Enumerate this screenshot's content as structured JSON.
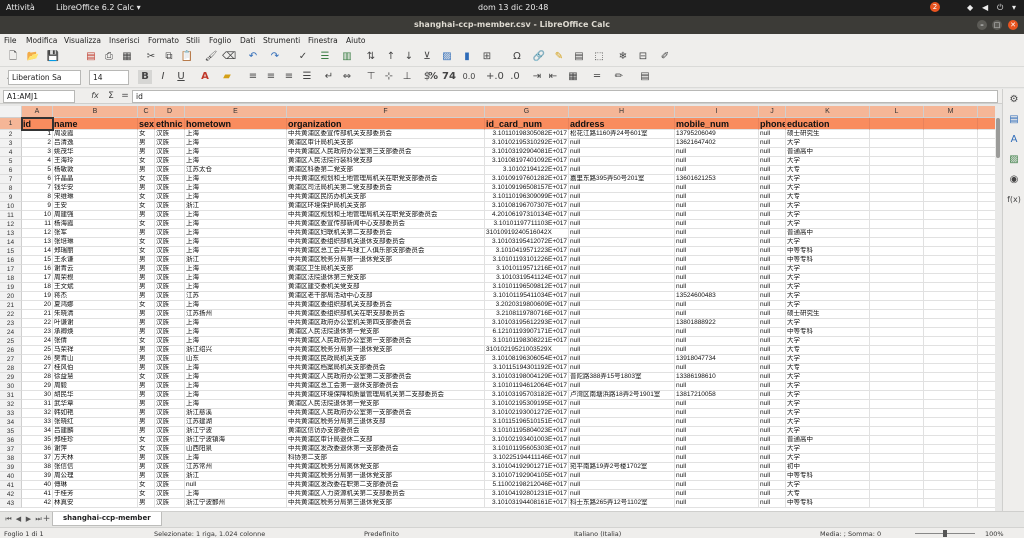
{
  "system_bar": {
    "activities": "Attività",
    "app_menu": "LibreOffice 6.2 Calc ▾",
    "clock": "dom 13 dic  20:48",
    "notification_count": "2"
  },
  "window": {
    "title": "shanghai-ccp-member.csv - LibreOffice Calc",
    "close_glyph": "✕",
    "maximize_glyph": "□",
    "minimize_glyph": "–"
  },
  "menubar": [
    "File",
    "Modifica",
    "Visualizza",
    "Inserisci",
    "Formato",
    "Stili",
    "Foglio",
    "Dati",
    "Strumenti",
    "Finestra",
    "Aiuto"
  ],
  "toolbar": {
    "font_name": "Liberation Sa",
    "font_size": "14",
    "bold": "B",
    "italic": "I",
    "underline": "U",
    "percent": "%",
    "number_format": "74",
    "decimal": "0.0",
    "icons": [
      "new-icon",
      "open-icon",
      "save-icon",
      "export-pdf-icon",
      "print-icon",
      "print-preview-icon",
      "cut-icon",
      "copy-icon",
      "paste-icon",
      "clone-icon",
      "clear-icon",
      "undo-icon",
      "redo-icon",
      "spellcheck-icon",
      "row-icon",
      "column-icon",
      "sort-icon",
      "sort-ascending-icon",
      "sort-descending-icon",
      "autofilter-icon",
      "image-icon",
      "chart-icon",
      "pivot-table-icon",
      "special-character-icon",
      "hyperlink-icon",
      "comment-icon",
      "header-footer-icon",
      "define-print-area-icon",
      "freeze-icon",
      "split-window-icon",
      "show-draw-icon"
    ]
  },
  "formula_bar": {
    "name_box": "A1:AMJ1",
    "fx": "fx",
    "sum": "Σ",
    "equals": "=",
    "content": "id"
  },
  "columns": [
    {
      "letter": "A",
      "header": "id"
    },
    {
      "letter": "B",
      "header": "name"
    },
    {
      "letter": "C",
      "header": "sex"
    },
    {
      "letter": "D",
      "header": "ethnic"
    },
    {
      "letter": "E",
      "header": "hometown"
    },
    {
      "letter": "F",
      "header": "organization"
    },
    {
      "letter": "G",
      "header": "id_card_num"
    },
    {
      "letter": "H",
      "header": "address"
    },
    {
      "letter": "I",
      "header": "mobile_num"
    },
    {
      "letter": "J",
      "header": "phone"
    },
    {
      "letter": "K",
      "header": "education"
    },
    {
      "letter": "L",
      "header": ""
    },
    {
      "letter": "M",
      "header": ""
    },
    {
      "letter": "N",
      "header": ""
    }
  ],
  "rows": [
    [
      "1",
      "周凌霞",
      "女",
      "汉族",
      "上海",
      "中共黄浦区委宣传部机关支部委员会",
      "3.10110198305082E+017",
      "松花江路1160弄24号601室",
      "13795206049",
      "null",
      "硕士研究生"
    ],
    [
      "2",
      "吕清逸",
      "男",
      "汉族",
      "上海",
      "黄浦区审计局机关支部",
      "3.10102195310292E+017",
      "null",
      "13621647402",
      "null",
      "大学"
    ],
    [
      "3",
      "姚茂华",
      "男",
      "汉族",
      "上海",
      "中共黄浦区人民政府办公室第三支部委员会",
      "3.10103192904081E+017",
      "null",
      "null",
      "null",
      "普通高中"
    ],
    [
      "4",
      "王海玲",
      "女",
      "汉族",
      "上海",
      "黄浦区人民法院行装科党支部",
      "3.10108197401092E+017",
      "null",
      "null",
      "null",
      "大学"
    ],
    [
      "5",
      "杨敏敦",
      "男",
      "汉族",
      "江苏太仓",
      "黄浦区科委第二党支部",
      "3.10102194122E+017",
      "null",
      "null",
      "null",
      "大专"
    ],
    [
      "6",
      "许晶晶",
      "女",
      "汉族",
      "上海",
      "中共黄浦区规划和土地管理局机关在职党支部委员会",
      "3.10109197601282E+017",
      "嘉里东路395弄50号201室",
      "13601621253",
      "null",
      "大学"
    ],
    [
      "7",
      "钱华安",
      "男",
      "汉族",
      "上海",
      "黄浦区司法局机关第二党支部委员会",
      "3.10109196508157E+017",
      "null",
      "null",
      "null",
      "大学"
    ],
    [
      "8",
      "宋维琳",
      "女",
      "汉族",
      "上海",
      "中共黄浦区民防办机关支部",
      "3.10110196309099E+017",
      "null",
      "null",
      "null",
      "大专"
    ],
    [
      "9",
      "王安",
      "女",
      "汉族",
      "浙江",
      "黄浦区环境保护局机关支部",
      "3.10108196707307E+017",
      "null",
      "null",
      "null",
      "大学"
    ],
    [
      "10",
      "周建强",
      "男",
      "汉族",
      "上海",
      "中共黄浦区规划和土地管理局机关在职党支部委员会",
      "4.20106197310134E+017",
      "null",
      "null",
      "null",
      "大学"
    ],
    [
      "11",
      "杨海霞",
      "女",
      "汉族",
      "上海",
      "中共黄浦区委宣传部新闻中心支部委员会",
      "3.10101197711103E+017",
      "null",
      "null",
      "null",
      "大学"
    ],
    [
      "12",
      "张军",
      "男",
      "汉族",
      "上海",
      "中共黄浦区妇联机关第二支部委员会",
      "31010919240516042X",
      "null",
      "null",
      "null",
      "普通高中"
    ],
    [
      "13",
      "张培琳",
      "女",
      "汉族",
      "上海",
      "中共黄浦区委组织部机关退休支部委员会",
      "3.10103195412072E+017",
      "null",
      "null",
      "null",
      "大学"
    ],
    [
      "14",
      "郑瑞丽",
      "女",
      "汉族",
      "上海",
      "中共黄浦区总工会乒乓球工人俱乐部支部委员会",
      "3.1010419571223E+017",
      "null",
      "null",
      "null",
      "中等专科"
    ],
    [
      "15",
      "王永谦",
      "男",
      "汉族",
      "浙江",
      "中共黄浦区税务分局第一退休党支部",
      "3.10101193101226E+017",
      "null",
      "null",
      "null",
      "中等专科"
    ],
    [
      "16",
      "谢青云",
      "男",
      "汉族",
      "上海",
      "黄浦区卫生局机关支部",
      "3.1010119571216E+017",
      "null",
      "null",
      "null",
      "大学"
    ],
    [
      "17",
      "周荣根",
      "男",
      "汉族",
      "上海",
      "黄浦区法院退休第三党支部",
      "3.1010319541124E+017",
      "null",
      "null",
      "null",
      "大学"
    ],
    [
      "18",
      "王文斌",
      "男",
      "汉族",
      "上海",
      "黄浦区建交委机关党支部",
      "3.10101196509812E+017",
      "null",
      "null",
      "null",
      "大学"
    ],
    [
      "19",
      "蒋杰",
      "男",
      "汉族",
      "江苏",
      "黄浦区老干部局活动中心支部",
      "3.10101195411034E+017",
      "null",
      "13524600483",
      "null",
      "大学"
    ],
    [
      "20",
      "夏鸿娜",
      "女",
      "汉族",
      "上海",
      "中共黄浦区委组织部机关支部委员会",
      "3.2020319800609E+017",
      "null",
      "null",
      "null",
      "大学"
    ],
    [
      "21",
      "朱晓清",
      "男",
      "汉族",
      "江苏扬州",
      "中共黄浦区委组织部机关在职支部委员会",
      "3.2108119780716E+017",
      "null",
      "null",
      "null",
      "硕士研究生"
    ],
    [
      "22",
      "叶谦谢",
      "男",
      "汉族",
      "上海",
      "中共黄浦区政府办公室机关第四支部委员会",
      "3.10103195612293E+017",
      "null",
      "13801888922",
      "null",
      "大学"
    ],
    [
      "23",
      "承卿焕",
      "男",
      "汉族",
      "上海",
      "黄浦区人民法院退休第一党支部",
      "6.12101193907171E+017",
      "null",
      "null",
      "null",
      "中等专科"
    ],
    [
      "24",
      "张倩",
      "女",
      "汉族",
      "上海",
      "中共黄浦区人民政府办公室第一支部委员会",
      "3.10101198308221E+017",
      "null",
      "null",
      "null",
      "大学"
    ],
    [
      "25",
      "马荣祥",
      "男",
      "汉族",
      "浙江绍兴",
      "中共黄浦区税务分局第一退休党支部",
      "31010219521003529X",
      "null",
      "null",
      "null",
      "大专"
    ],
    [
      "26",
      "樊青山",
      "男",
      "汉族",
      "山东",
      "中共黄浦区民政局机关支部",
      "3.10108196306054E+017",
      "null",
      "13918047734",
      "null",
      "大学"
    ],
    [
      "27",
      "桂风伯",
      "男",
      "汉族",
      "上海",
      "中共黄浦区档案局机关支部委员会",
      "3.10115194301192E+017",
      "null",
      "null",
      "null",
      "大专"
    ],
    [
      "28",
      "徐益慧",
      "女",
      "汉族",
      "上海",
      "中共黄浦区人民政府办公室第二支部委员会",
      "3.10103198004129E+017",
      "普陀路388弄15号1803室",
      "13386198610",
      "null",
      "大学"
    ],
    [
      "29",
      "周毅",
      "男",
      "汉族",
      "上海",
      "中共黄浦区总工会第一退休支部委员会",
      "3.10101194612064E+017",
      "null",
      "null",
      "null",
      "大学"
    ],
    [
      "30",
      "胡民华",
      "男",
      "汉族",
      "上海",
      "中共黄浦区环境保障和质量管理局机关第二支部委员会",
      "3.10103195703182E+017",
      "卢湾区南塘浜路18弄2号1901室",
      "13817210058",
      "null",
      "大学"
    ],
    [
      "31",
      "武华章",
      "男",
      "汉族",
      "上海",
      "黄浦区人民法院退休第一党支部",
      "3.10102195309195E+017",
      "null",
      "null",
      "null",
      "大学"
    ],
    [
      "32",
      "韩如艳",
      "男",
      "汉族",
      "浙江慈溪",
      "中共黄浦区人民政府办公室第一支部委员会",
      "3.10102193001272E+017",
      "null",
      "null",
      "null",
      "大学"
    ],
    [
      "33",
      "张晓红",
      "男",
      "汉族",
      "江苏建湖",
      "中共黄浦区税务分局第三退休支部",
      "3.10115196510151E+017",
      "null",
      "null",
      "null",
      "大学"
    ],
    [
      "34",
      "吕建麟",
      "男",
      "汉族",
      "浙江宁波",
      "黄浦区信访办支部委员会",
      "3.10101195804023E+017",
      "null",
      "null",
      "null",
      "大学"
    ],
    [
      "35",
      "郑桂珍",
      "女",
      "汉族",
      "浙江宁波镇海",
      "中共黄浦区审计局退休二支部",
      "3.10102193401003E+017",
      "null",
      "null",
      "null",
      "普通高中"
    ],
    [
      "36",
      "谢萍",
      "女",
      "汉族",
      "山西阳泉",
      "中共黄浦区发改委退休第一支部委员会",
      "3.10101195605303E+017",
      "null",
      "null",
      "null",
      "大学"
    ],
    [
      "37",
      "方天林",
      "男",
      "汉族",
      "上海",
      "科协第二支部",
      "3.10225194411146E+017",
      "null",
      "null",
      "null",
      "大学"
    ],
    [
      "38",
      "张信信",
      "男",
      "汉族",
      "江苏常州",
      "中共黄浦区税务分局离休党支部",
      "3.10104192901271E+017",
      "宛平南路19弄2号楼1702室",
      "null",
      "null",
      "初中"
    ],
    [
      "39",
      "周公理",
      "男",
      "汉族",
      "浙江",
      "中共黄浦区税务分局第一退休党支部",
      "3.10107192904105E+017",
      "null",
      "null",
      "null",
      "中等专科"
    ],
    [
      "40",
      "傅琳",
      "女",
      "汉族",
      "null",
      "中共黄浦区发改委在职第二支部委员会",
      "5.11002198212046E+017",
      "null",
      "null",
      "null",
      "大学"
    ],
    [
      "41",
      "于桂芳",
      "女",
      "汉族",
      "上海",
      "中共黄浦区人力资源机关第二支部委员会",
      "3.10104192801231E+017",
      "null",
      "null",
      "null",
      "大专"
    ],
    [
      "42",
      "林真安",
      "男",
      "汉族",
      "浙江宁波鄞州",
      "中共黄浦区税务分局第三退休党支部",
      "3.10103194408161E+017",
      "科士东路265弄12号1102室",
      "null",
      "null",
      "中等专科"
    ]
  ],
  "sheet_tab": "shanghai-ccp-member",
  "status": {
    "sheet": "Foglio 1 di 1",
    "selection": "Selezionate: 1 riga, 1.024 colonne",
    "style": "Predefinito",
    "language": "Italiano (Italia)",
    "summary": "Media: ; Somma: 0",
    "zoom": "100%"
  },
  "colors": {
    "header_fill": "#f98c5e",
    "selected_header": "#f5b697",
    "ubuntu_orange": "#e95420"
  }
}
